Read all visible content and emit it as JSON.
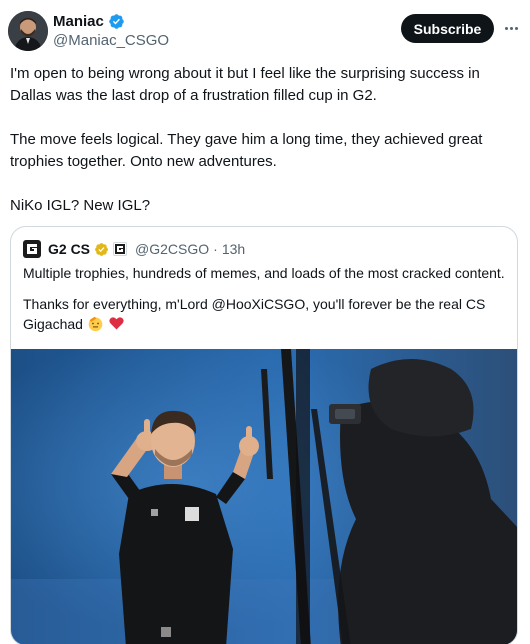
{
  "author": {
    "name": "Maniac",
    "handle": "@Maniac_CSGO"
  },
  "actions": {
    "subscribe_label": "Subscribe",
    "more_icon": "more-horizontal-icon"
  },
  "tweet": {
    "paragraphs": [
      "I'm open to being wrong about it but I feel like the surprising success in Dallas was the last drop of a frustration filled cup in G2.",
      "The move feels logical. They gave him a long time, they achieved great trophies together. Onto new adventures.",
      "NiKo IGL? New IGL?"
    ]
  },
  "quote": {
    "name": "G2 CS",
    "handle": "@G2CSGO",
    "separator": "·",
    "time": "13h",
    "line1": "Multiple trophies, hundreds of memes, and loads of the most cracked content.",
    "line2": "Thanks for everything, m'Lord @HooXiCSGO, you'll forever be the real CS Gigachad",
    "emojis": [
      "saluting-face-emoji",
      "red-heart-emoji"
    ]
  },
  "colors": {
    "text": "#0f1419",
    "secondary": "#536471",
    "verified_blue": "#1d9bf0",
    "verified_gold": "#e2b719",
    "border": "#cfd9de",
    "studio_blue": "#1f5f9e"
  }
}
